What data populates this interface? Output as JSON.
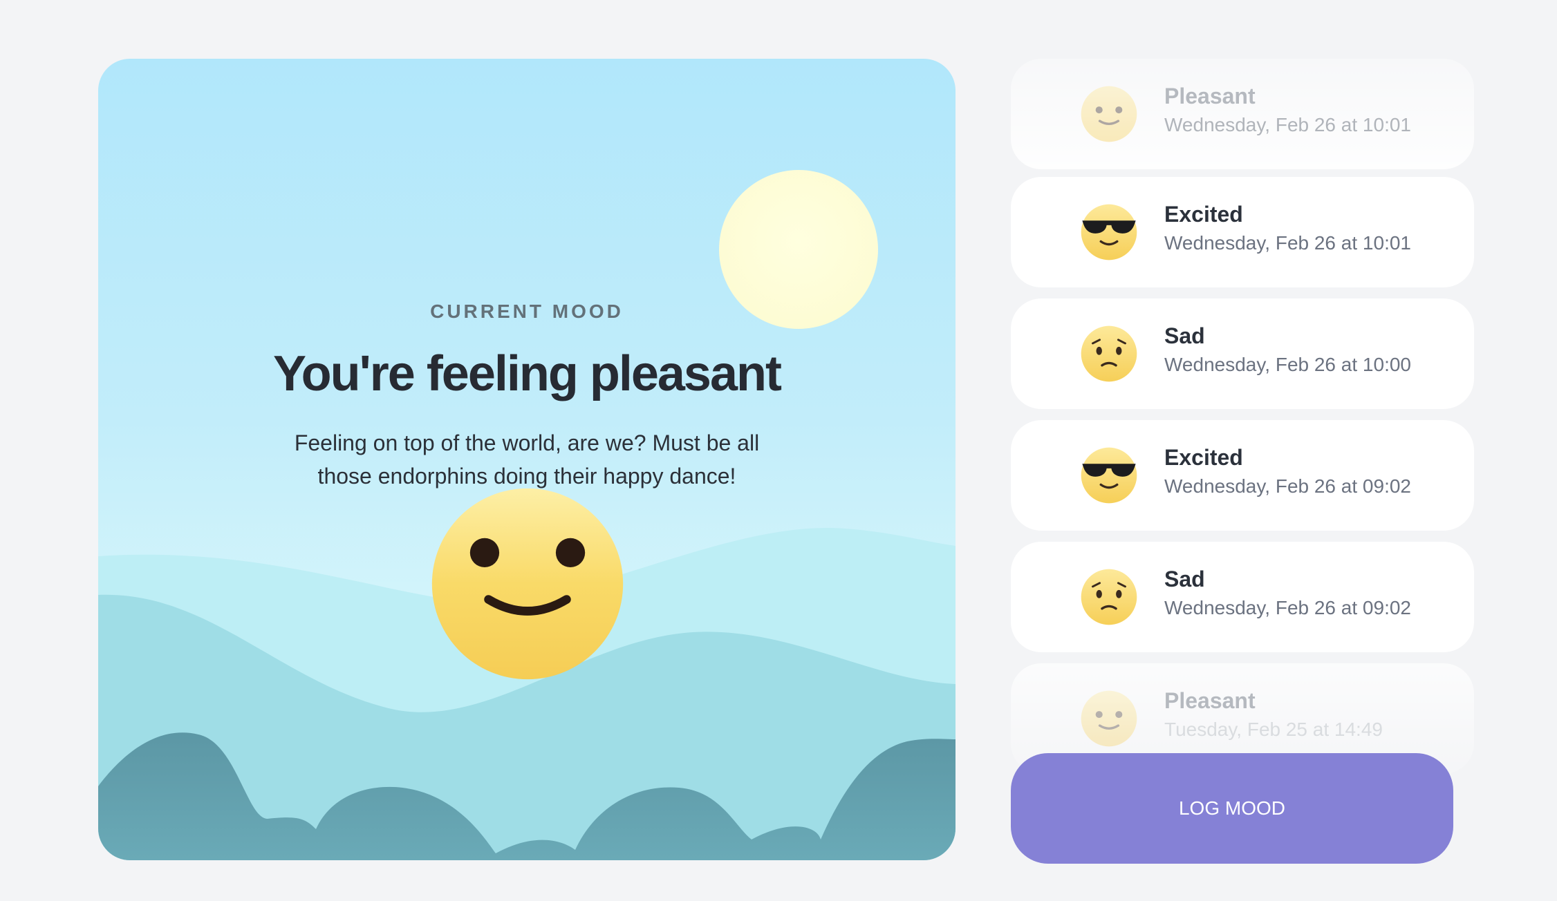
{
  "hero": {
    "eyebrow": "CURRENT MOOD",
    "headline": "You're feeling pleasant",
    "description": "Feeling on top of the world, are we? Must be all those endorphins doing their happy dance!",
    "face_icon": "pleasant-face-icon"
  },
  "history": [
    {
      "mood": "Pleasant",
      "time": "Wednesday, Feb 26 at 10:01",
      "icon": "pleasant-face-icon"
    },
    {
      "mood": "Excited",
      "time": "Wednesday, Feb 26 at 10:01",
      "icon": "sunglasses-face-icon"
    },
    {
      "mood": "Sad",
      "time": "Wednesday, Feb 26 at 10:00",
      "icon": "sad-face-icon"
    },
    {
      "mood": "Excited",
      "time": "Wednesday, Feb 26 at 09:02",
      "icon": "sunglasses-face-icon"
    },
    {
      "mood": "Sad",
      "time": "Wednesday, Feb 26 at 09:02",
      "icon": "sad-face-icon"
    },
    {
      "mood": "Pleasant",
      "time": "Tuesday, Feb 25 at 14:49",
      "icon": "pleasant-face-icon"
    }
  ],
  "actions": {
    "log_label": "LOG MOOD"
  },
  "colors": {
    "accent": "#8581d6",
    "sky_top": "#b1e7fb",
    "hill_dark": "#5e98a6",
    "sun": "#fdfcd4"
  }
}
